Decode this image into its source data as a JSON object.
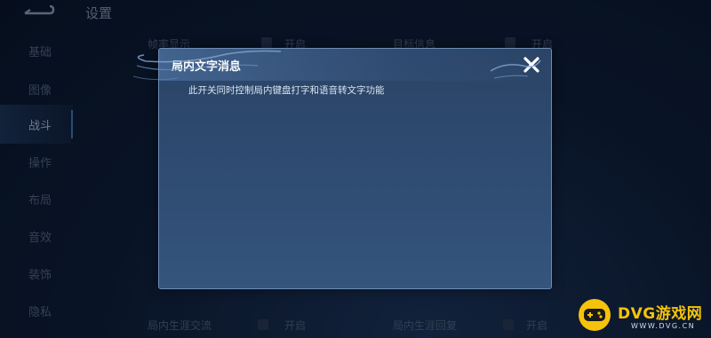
{
  "header": {
    "title": "设置"
  },
  "sidebar": {
    "items": [
      {
        "label": "基础"
      },
      {
        "label": "图像"
      },
      {
        "label": "战斗"
      },
      {
        "label": "操作"
      },
      {
        "label": "布局"
      },
      {
        "label": "音效"
      },
      {
        "label": "装饰"
      },
      {
        "label": "隐私"
      }
    ],
    "active_index": 2
  },
  "background_settings": {
    "frame_rate_label": "帧率显示",
    "frame_rate_value": "开启",
    "target_info_label": "目标信息",
    "target_info_value": "开启",
    "in_game_chat_label": "局内生涯交流",
    "in_game_chat_value": "开启",
    "in_game_reply_label": "局内生涯回复",
    "in_game_reply_value": "开启"
  },
  "dialog": {
    "title": "局内文字消息",
    "message": "此开关同时控制局内键盘打字和语音转文字功能"
  },
  "watermark": {
    "brand": "DVG游戏网",
    "url": "WWW.DVG.CN"
  },
  "colors": {
    "dialog_bg": "#2f4c72",
    "dialog_border": "#6d8db5",
    "watermark_yellow": "#f5c30b"
  }
}
